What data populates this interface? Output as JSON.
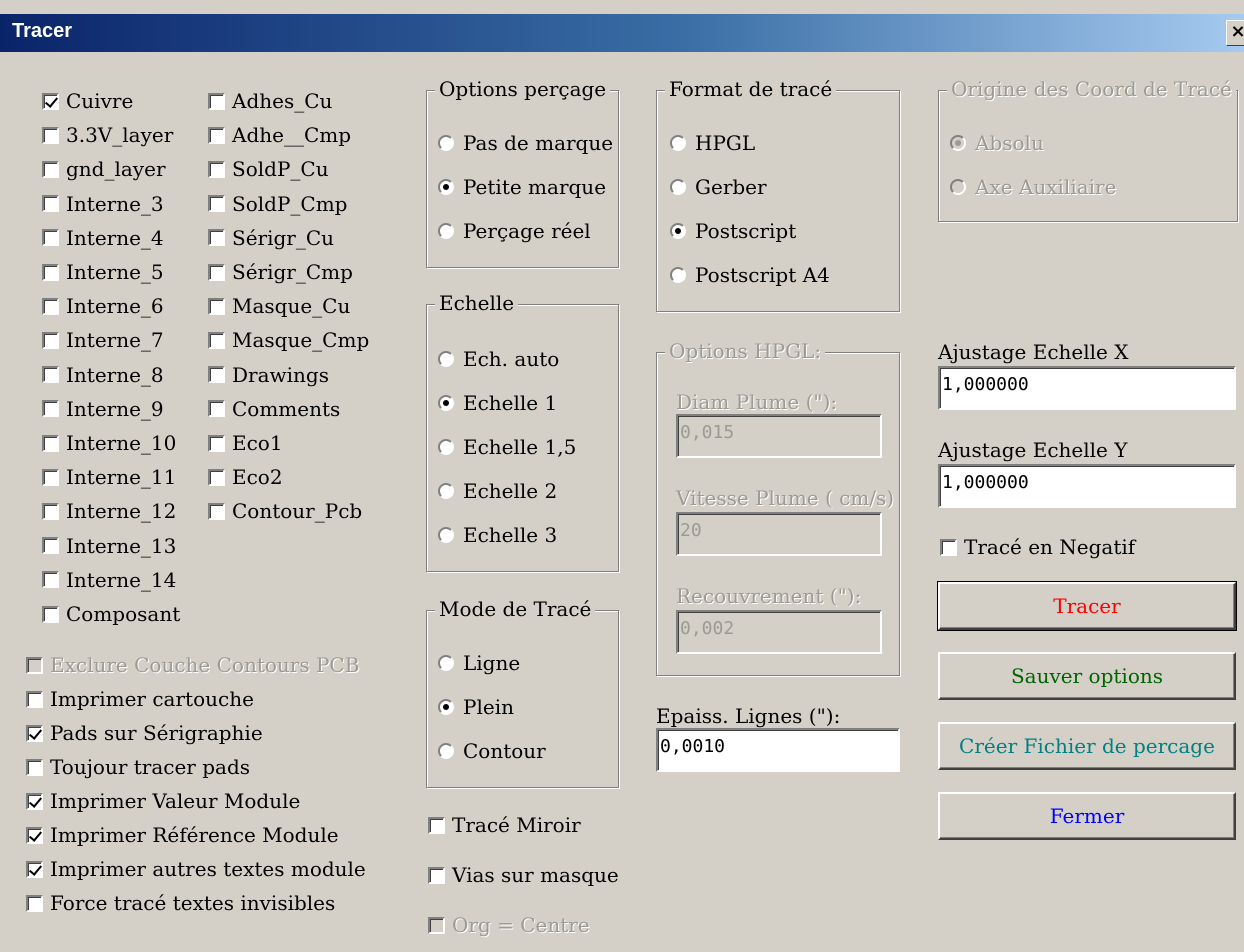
{
  "window": {
    "title": "Tracer",
    "close_label": "×"
  },
  "layers": {
    "col1": [
      {
        "label": "Cuivre",
        "checked": true
      },
      {
        "label": "3.3V_layer",
        "checked": false
      },
      {
        "label": "gnd_layer",
        "checked": false
      },
      {
        "label": "Interne_3",
        "checked": false
      },
      {
        "label": "Interne_4",
        "checked": false
      },
      {
        "label": "Interne_5",
        "checked": false
      },
      {
        "label": "Interne_6",
        "checked": false
      },
      {
        "label": "Interne_7",
        "checked": false
      },
      {
        "label": "Interne_8",
        "checked": false
      },
      {
        "label": "Interne_9",
        "checked": false
      },
      {
        "label": "Interne_10",
        "checked": false
      },
      {
        "label": "Interne_11",
        "checked": false
      },
      {
        "label": "Interne_12",
        "checked": false
      },
      {
        "label": "Interne_13",
        "checked": false
      },
      {
        "label": "Interne_14",
        "checked": false
      },
      {
        "label": "Composant",
        "checked": false
      }
    ],
    "col2": [
      {
        "label": "Adhes_Cu",
        "checked": false
      },
      {
        "label": "Adhe__Cmp",
        "checked": false
      },
      {
        "label": "SoldP_Cu",
        "checked": false
      },
      {
        "label": "SoldP_Cmp",
        "checked": false
      },
      {
        "label": "Sérigr_Cu",
        "checked": false
      },
      {
        "label": "Sérigr_Cmp",
        "checked": false
      },
      {
        "label": "Masque_Cu",
        "checked": false
      },
      {
        "label": "Masque_Cmp",
        "checked": false
      },
      {
        "label": "Drawings",
        "checked": false
      },
      {
        "label": "Comments",
        "checked": false
      },
      {
        "label": "Eco1",
        "checked": false
      },
      {
        "label": "Eco2",
        "checked": false
      },
      {
        "label": "Contour_Pcb",
        "checked": false
      }
    ]
  },
  "print_options": [
    {
      "label": "Exclure Couche Contours PCB",
      "checked": false,
      "disabled": true
    },
    {
      "label": "Imprimer cartouche",
      "checked": false
    },
    {
      "label": "Pads sur Sérigraphie",
      "checked": true
    },
    {
      "label": "Toujour tracer pads",
      "checked": false
    },
    {
      "label": "Imprimer Valeur Module",
      "checked": true
    },
    {
      "label": "Imprimer Référence Module",
      "checked": true
    },
    {
      "label": "Imprimer autres textes  module",
      "checked": true
    },
    {
      "label": "Force tracé textes invisibles",
      "checked": false
    }
  ],
  "drill_options": {
    "title": "Options perçage",
    "items": [
      {
        "label": "Pas de marque",
        "selected": false
      },
      {
        "label": "Petite marque",
        "selected": true
      },
      {
        "label": "Perçage réel",
        "selected": false
      }
    ]
  },
  "scale": {
    "title": "Echelle",
    "items": [
      {
        "label": "Ech. auto",
        "selected": false
      },
      {
        "label": "Echelle 1",
        "selected": true
      },
      {
        "label": "Echelle 1,5",
        "selected": false
      },
      {
        "label": "Echelle 2",
        "selected": false
      },
      {
        "label": "Echelle 3",
        "selected": false
      }
    ]
  },
  "plot_mode": {
    "title": "Mode de Tracé",
    "items": [
      {
        "label": "Ligne",
        "selected": false
      },
      {
        "label": "Plein",
        "selected": true
      },
      {
        "label": "Contour",
        "selected": false
      }
    ]
  },
  "mid_checks": [
    {
      "label": "Tracé Miroir",
      "checked": false
    },
    {
      "label": "Vias sur masque",
      "checked": false
    },
    {
      "label": "Org = Centre",
      "checked": false,
      "disabled": true
    }
  ],
  "format": {
    "title": "Format de tracé",
    "items": [
      {
        "label": "HPGL",
        "selected": false
      },
      {
        "label": "Gerber",
        "selected": false
      },
      {
        "label": "Postscript",
        "selected": true
      },
      {
        "label": "Postscript A4",
        "selected": false
      }
    ]
  },
  "hpgl": {
    "title": "Options HPGL:",
    "pen_diam_label": "Diam Plume (\"):",
    "pen_diam_value": "0,015",
    "pen_speed_label": "Vitesse Plume ( cm/s)",
    "pen_speed_value": "20",
    "overlap_label": "Recouvrement (\"):",
    "overlap_value": "0,002"
  },
  "line_width": {
    "label": "Epaiss. Lignes (\"):",
    "value": "0,0010"
  },
  "origin": {
    "title": "Origine des Coord de Tracé",
    "items": [
      {
        "label": "Absolu",
        "selected": true
      },
      {
        "label": "Axe Auxiliaire",
        "selected": false
      }
    ]
  },
  "scale_x": {
    "label": "Ajustage Echelle X",
    "value": "1,000000"
  },
  "scale_y": {
    "label": "Ajustage Echelle Y",
    "value": "1,000000"
  },
  "negative": {
    "label": "Tracé en Negatif",
    "checked": false
  },
  "buttons": {
    "plot": {
      "label": "Tracer",
      "color": "#ff0000"
    },
    "save": {
      "label": "Sauver options",
      "color": "#006400"
    },
    "drill": {
      "label": "Créer Fichier de percage",
      "color": "#008080"
    },
    "close": {
      "label": "Fermer",
      "color": "#0000ff"
    }
  }
}
